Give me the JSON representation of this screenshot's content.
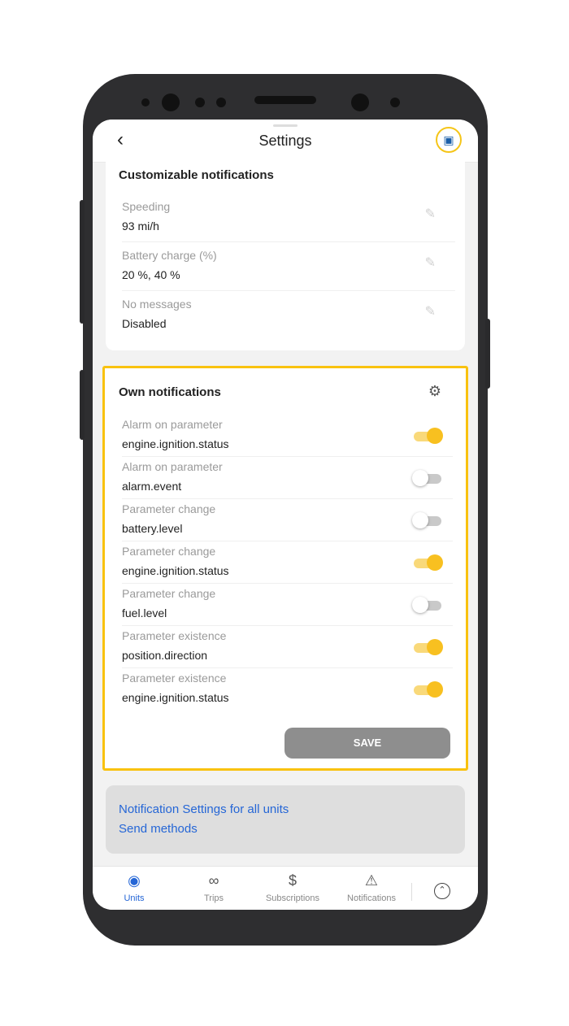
{
  "header": {
    "back_icon": "chevron-left-icon",
    "title": "Settings",
    "vehicle_icon": "car-icon"
  },
  "customizable": {
    "title": "Customizable notifications",
    "items": [
      {
        "label": "Speeding",
        "value": "93 mi/h"
      },
      {
        "label": "Battery charge (%)",
        "value": "20 %, 40 %"
      },
      {
        "label": "No messages",
        "value": "Disabled"
      }
    ]
  },
  "own": {
    "title": "Own notifications",
    "items": [
      {
        "label": "Alarm on parameter",
        "value": "engine.ignition.status",
        "enabled": true
      },
      {
        "label": "Alarm on parameter",
        "value": "alarm.event",
        "enabled": false
      },
      {
        "label": "Parameter change",
        "value": "battery.level",
        "enabled": false
      },
      {
        "label": "Parameter change",
        "value": "engine.ignition.status",
        "enabled": true
      },
      {
        "label": "Parameter change",
        "value": "fuel.level",
        "enabled": false
      },
      {
        "label": "Parameter existence",
        "value": "position.direction",
        "enabled": true
      },
      {
        "label": "Parameter existence",
        "value": "engine.ignition.status",
        "enabled": true
      }
    ],
    "save_label": "SAVE"
  },
  "links": {
    "all_units": "Notification Settings for all units",
    "send_methods": "Send methods"
  },
  "tabs": [
    {
      "label": "Units",
      "icon": "location-pin-icon",
      "active": true
    },
    {
      "label": "Trips",
      "icon": "route-icon",
      "active": false
    },
    {
      "label": "Subscriptions",
      "icon": "dollar-icon",
      "active": false
    },
    {
      "label": "Notifications",
      "icon": "bell-icon",
      "active": false
    }
  ],
  "colors": {
    "accent": "#f9c20f",
    "link": "#2566d6",
    "save_bg": "#8e8e8e"
  }
}
